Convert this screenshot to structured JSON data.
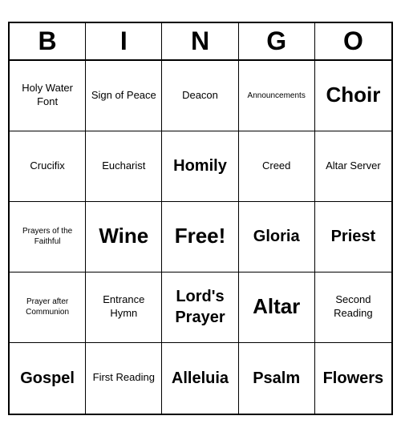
{
  "header": {
    "letters": [
      "B",
      "I",
      "N",
      "G",
      "O"
    ]
  },
  "cells": [
    {
      "text": "Holy Water Font",
      "size": "normal"
    },
    {
      "text": "Sign of Peace",
      "size": "normal"
    },
    {
      "text": "Deacon",
      "size": "normal"
    },
    {
      "text": "Announcements",
      "size": "small"
    },
    {
      "text": "Choir",
      "size": "xlarge"
    },
    {
      "text": "Crucifix",
      "size": "normal"
    },
    {
      "text": "Eucharist",
      "size": "normal"
    },
    {
      "text": "Homily",
      "size": "large"
    },
    {
      "text": "Creed",
      "size": "normal"
    },
    {
      "text": "Altar Server",
      "size": "normal"
    },
    {
      "text": "Prayers of the Faithful",
      "size": "small"
    },
    {
      "text": "Wine",
      "size": "xlarge"
    },
    {
      "text": "Free!",
      "size": "xlarge"
    },
    {
      "text": "Gloria",
      "size": "large"
    },
    {
      "text": "Priest",
      "size": "large"
    },
    {
      "text": "Prayer after Communion",
      "size": "small"
    },
    {
      "text": "Entrance Hymn",
      "size": "normal"
    },
    {
      "text": "Lord's Prayer",
      "size": "large"
    },
    {
      "text": "Altar",
      "size": "xlarge"
    },
    {
      "text": "Second Reading",
      "size": "normal"
    },
    {
      "text": "Gospel",
      "size": "large"
    },
    {
      "text": "First Reading",
      "size": "normal"
    },
    {
      "text": "Alleluia",
      "size": "large"
    },
    {
      "text": "Psalm",
      "size": "large"
    },
    {
      "text": "Flowers",
      "size": "large"
    }
  ]
}
